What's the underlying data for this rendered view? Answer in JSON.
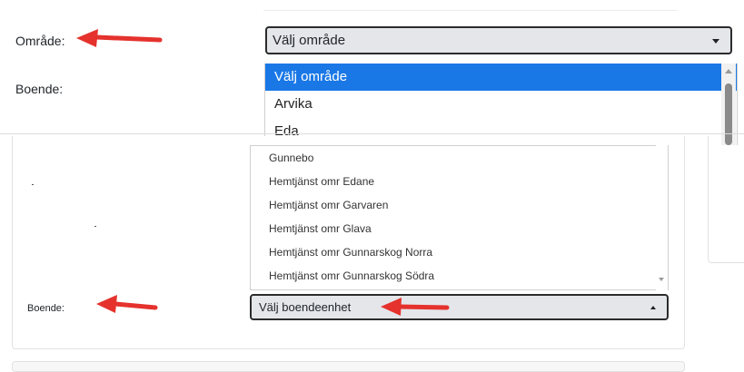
{
  "form_top": {
    "omrade_label": "Område:",
    "boende_label": "Boende:",
    "omrade_select_value": "Välj område",
    "omrade_options": [
      "Välj område",
      "Arvika",
      "Eda"
    ]
  },
  "form_bottom": {
    "boende_label": "Boende:",
    "boende_select_value": "Välj boendeenhet",
    "boende_options": [
      "Gunnebo",
      "Hemtjänst omr Edane",
      "Hemtjänst omr Garvaren",
      "Hemtjänst omr Glava",
      "Hemtjänst omr Gunnarskog Norra",
      "Hemtjänst omr Gunnarskog Södra"
    ]
  },
  "colors": {
    "selected_option": "#1a78e6",
    "select_background": "#e4e6ea",
    "annotation_arrow": "#e5322d"
  },
  "icons": {
    "caret_down": "caret-down-icon",
    "caret_up": "caret-up-icon",
    "annotation": "red-arrow-icon"
  }
}
